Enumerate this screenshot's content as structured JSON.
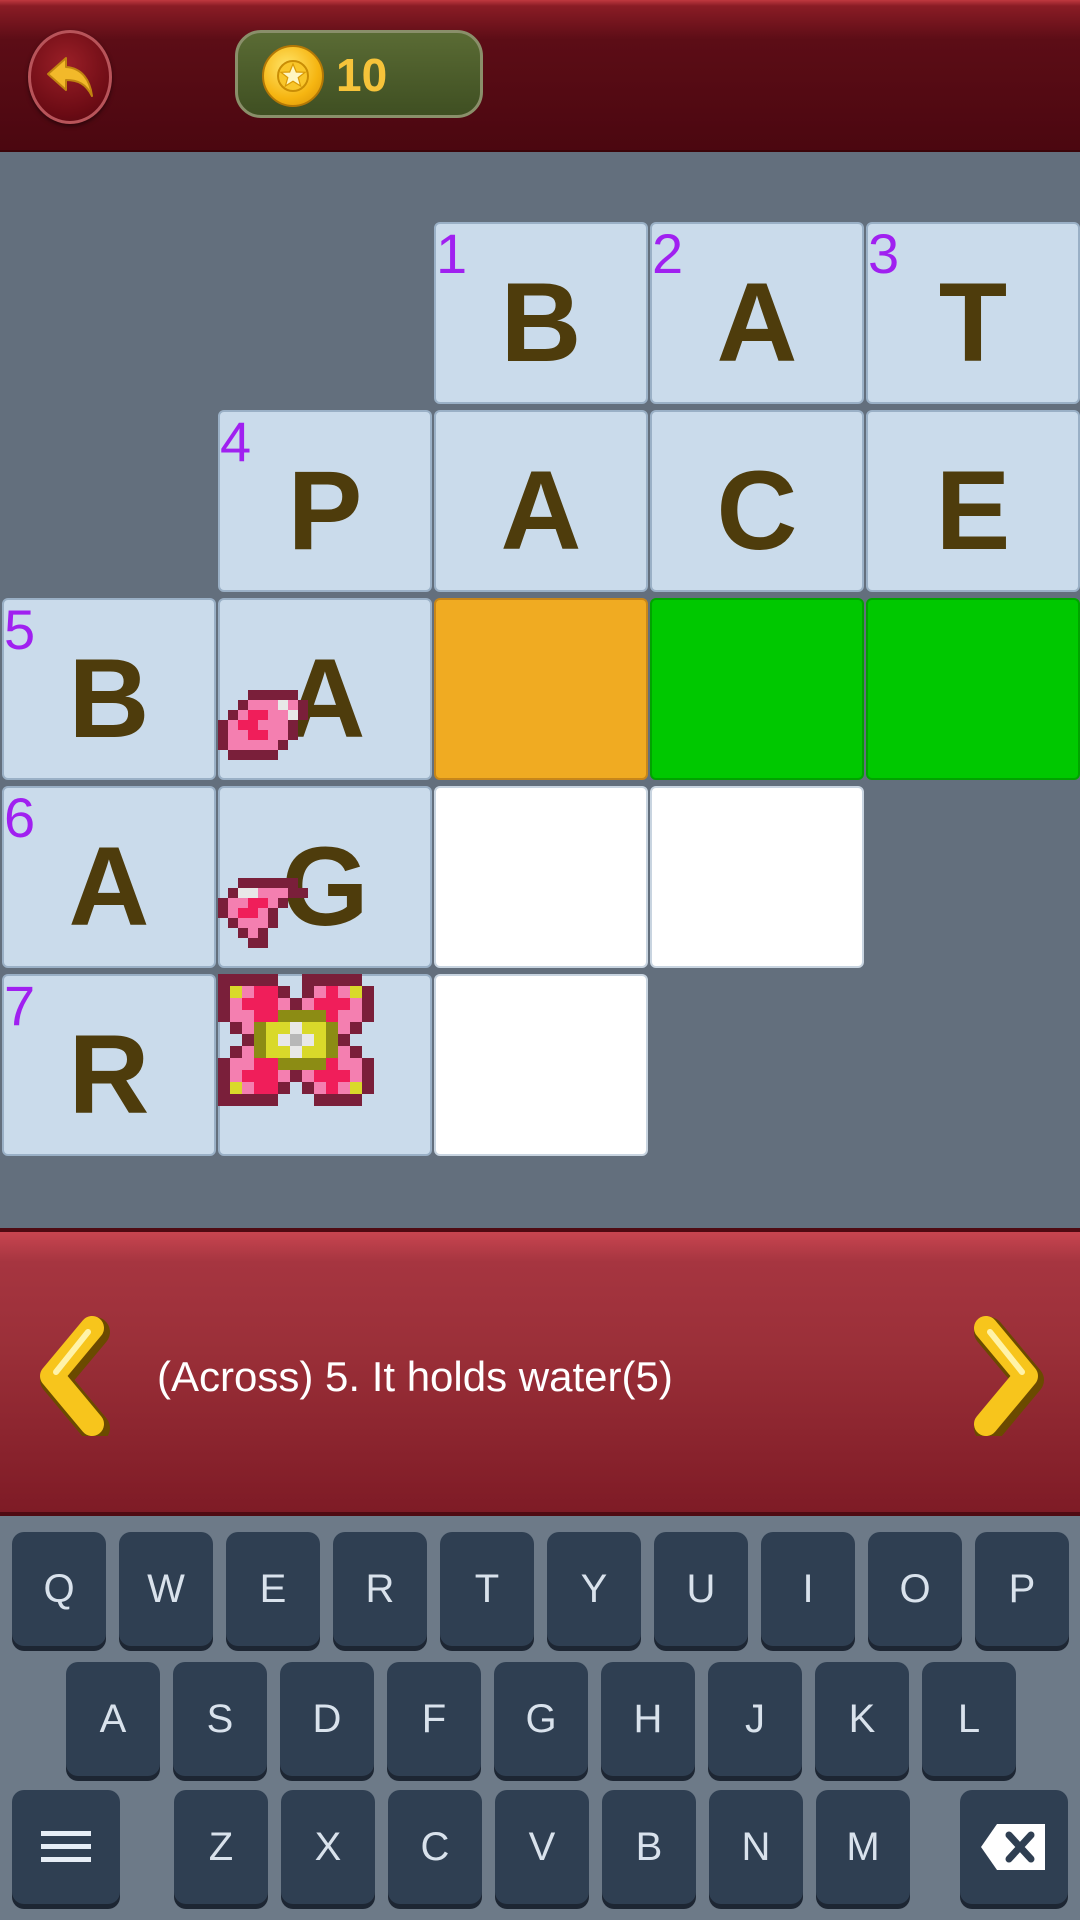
{
  "header": {
    "coins": "10",
    "back_icon": "back-arrow-icon",
    "coin_icon": "star-coin-icon"
  },
  "board": {
    "cells": [
      {
        "row": 0,
        "col": 2,
        "letter": "B",
        "number": "1",
        "state": "filled"
      },
      {
        "row": 0,
        "col": 3,
        "letter": "A",
        "number": "2",
        "state": "filled"
      },
      {
        "row": 0,
        "col": 4,
        "letter": "T",
        "number": "3",
        "state": "filled"
      },
      {
        "row": 1,
        "col": 1,
        "letter": "P",
        "number": "4",
        "state": "filled"
      },
      {
        "row": 1,
        "col": 2,
        "letter": "A",
        "number": "",
        "state": "filled"
      },
      {
        "row": 1,
        "col": 3,
        "letter": "C",
        "number": "",
        "state": "filled"
      },
      {
        "row": 1,
        "col": 4,
        "letter": "E",
        "number": "",
        "state": "filled"
      },
      {
        "row": 2,
        "col": 0,
        "letter": "B",
        "number": "5",
        "state": "filled"
      },
      {
        "row": 2,
        "col": 1,
        "letter": "A",
        "number": "",
        "state": "filled"
      },
      {
        "row": 2,
        "col": 2,
        "letter": "",
        "number": "",
        "state": "active"
      },
      {
        "row": 2,
        "col": 3,
        "letter": "",
        "number": "",
        "state": "highlight"
      },
      {
        "row": 2,
        "col": 4,
        "letter": "",
        "number": "",
        "state": "highlight"
      },
      {
        "row": 3,
        "col": 0,
        "letter": "A",
        "number": "6",
        "state": "filled"
      },
      {
        "row": 3,
        "col": 1,
        "letter": "G",
        "number": "",
        "state": "filled"
      },
      {
        "row": 3,
        "col": 2,
        "letter": "",
        "number": "",
        "state": "empty"
      },
      {
        "row": 3,
        "col": 3,
        "letter": "",
        "number": "",
        "state": "empty"
      },
      {
        "row": 4,
        "col": 0,
        "letter": "R",
        "number": "7",
        "state": "filled"
      },
      {
        "row": 4,
        "col": 1,
        "letter": "",
        "number": "",
        "state": "filled"
      },
      {
        "row": 4,
        "col": 2,
        "letter": "",
        "number": "",
        "state": "empty"
      }
    ],
    "colors": {
      "filled": "#cadbeb",
      "empty": "#ffffff",
      "active": "#f0ab22",
      "highlight": "#00c800",
      "number": "#a020f0",
      "letter": "#4e3c0c"
    },
    "decorations": [
      "pixel-flower-icon",
      "pixel-petal-icon"
    ]
  },
  "clue": {
    "text": "(Across) 5. It holds water(5)",
    "prev_icon": "chevron-left-icon",
    "next_icon": "chevron-right-icon"
  },
  "keyboard": {
    "rows": [
      [
        "Q",
        "W",
        "E",
        "R",
        "T",
        "Y",
        "U",
        "I",
        "O",
        "P"
      ],
      [
        "A",
        "S",
        "D",
        "F",
        "G",
        "H",
        "J",
        "K",
        "L"
      ],
      [
        "Z",
        "X",
        "C",
        "V",
        "B",
        "N",
        "M"
      ]
    ],
    "menu_icon": "menu-icon",
    "backspace_icon": "backspace-icon"
  }
}
